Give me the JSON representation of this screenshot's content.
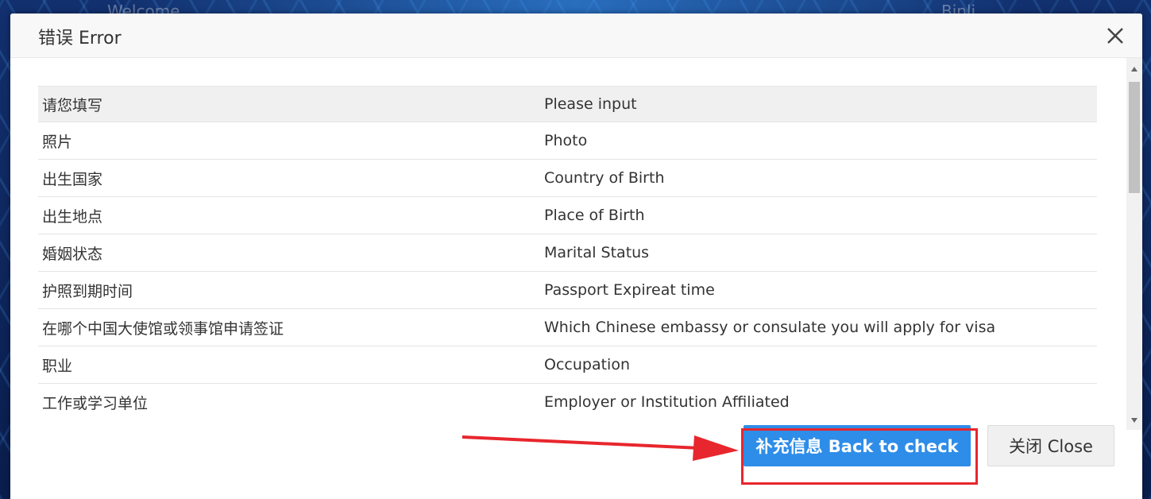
{
  "background": {
    "left_text": "Welcome",
    "right_text": "Binli"
  },
  "dialog": {
    "title": "错误 Error",
    "close_icon": "close-icon",
    "columns": [
      "请您填写",
      "Please input"
    ],
    "rows": [
      {
        "cn": "照片",
        "en": "Photo"
      },
      {
        "cn": "出生国家",
        "en": "Country of Birth"
      },
      {
        "cn": "出生地点",
        "en": "Place of Birth"
      },
      {
        "cn": "婚姻状态",
        "en": "Marital Status"
      },
      {
        "cn": "护照到期时间",
        "en": "Passport Expireat time"
      },
      {
        "cn": "在哪个中国大使馆或领事馆申请签证",
        "en": "Which Chinese embassy or consulate you will apply for visa"
      },
      {
        "cn": "职业",
        "en": "Occupation"
      },
      {
        "cn": "工作或学习单位",
        "en": "Employer or Institution Affiliated"
      }
    ],
    "buttons": {
      "back_to_check": "补充信息 Back to check",
      "close": "关闭 Close"
    }
  },
  "annotation": {
    "arrow_color": "#e8262d",
    "box_color": "#e8262d"
  },
  "colors": {
    "primary": "#2e8de8",
    "header_bg": "#f8f8f8",
    "table_head_bg": "#f0f0f0"
  }
}
